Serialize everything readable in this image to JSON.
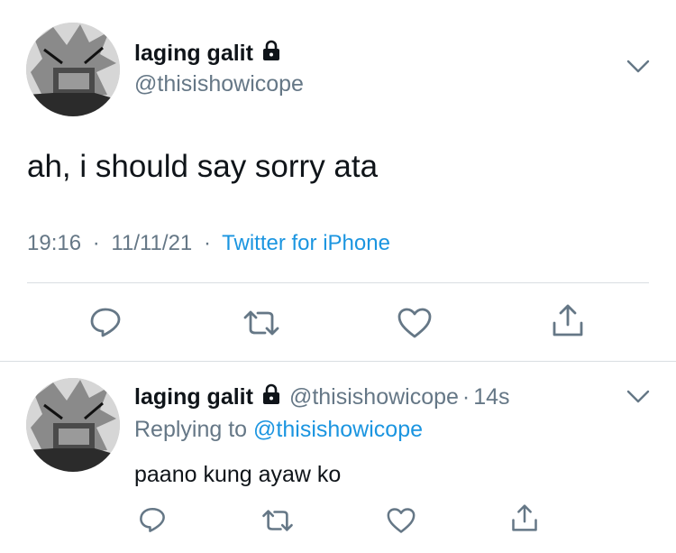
{
  "main_tweet": {
    "display_name": "laging galit",
    "handle": "@thisishowicope",
    "text": "ah, i should say sorry ata",
    "time": "19:16",
    "date": "11/11/21",
    "sep": "·",
    "source": "Twitter for iPhone",
    "icons": [
      "avatar",
      "lock-icon",
      "chevron-down-icon",
      "reply-icon",
      "retweet-icon",
      "like-icon",
      "share-icon"
    ]
  },
  "reply_tweet": {
    "display_name": "laging galit",
    "handle": "@thisishowicope",
    "sep": "·",
    "age": "14s",
    "replying_prefix": "Replying to",
    "replying_handle": "@thisishowicope",
    "text": "paano kung ayaw ko"
  },
  "colors": {
    "link": "#1b95e0",
    "muted": "#657786",
    "text": "#0f1419",
    "divider": "#d9dee2"
  }
}
